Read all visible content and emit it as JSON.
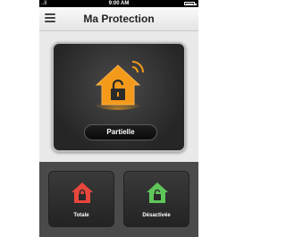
{
  "status_bar": {
    "time": "9:00 AM",
    "signal": "..ll"
  },
  "header": {
    "title": "Ma Protection"
  },
  "current_mode": {
    "label": "Partielle",
    "color": "#f39a1b"
  },
  "actions": [
    {
      "label": "Totale",
      "color": "#e8463c"
    },
    {
      "label": "Désactivée",
      "color": "#5fc65a"
    }
  ]
}
